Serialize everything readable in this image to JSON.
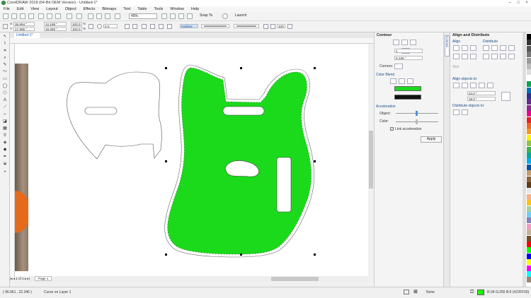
{
  "window": {
    "title": "CorelDRAW 2018 (64-Bit OEM Version) - Untitled-1*"
  },
  "menu": [
    "File",
    "Edit",
    "View",
    "Layout",
    "Object",
    "Effects",
    "Bitmaps",
    "Text",
    "Table",
    "Tools",
    "Window",
    "Help"
  ],
  "toolbar": {
    "zoom": "45%",
    "snap": "Snap To",
    "launch": "Launch"
  },
  "propbar": {
    "x": "36.994 \"",
    "y": "17.685 \"",
    "w": "12.188 \"",
    "h": "15.083 \"",
    "sx": "100.0",
    "sy": "100.0",
    "sx_unit": "%",
    "sy_unit": "%",
    "angle": "0.0",
    "outline": "Hairline",
    "opacity": "100"
  },
  "document": {
    "tab": "Untitled-1*"
  },
  "pagebar": {
    "page_num": "1",
    "page_of": "of",
    "page_total": "1",
    "page_label": "Page 1"
  },
  "contour": {
    "title": "Contour",
    "steps": "1",
    "offset": "0.125 \"",
    "corners_label": "Corners:",
    "color_blend": "Color Blend",
    "acceleration": "Acceleration",
    "object_label": "Object:",
    "color_label": "Color:",
    "link_label": "Link acceleration",
    "apply": "Apply",
    "outline_color": "#1bd91b",
    "fill_color": "#111111"
  },
  "align": {
    "title": "Align and Distribute",
    "align_label": "Align",
    "distribute_label": "Distribute",
    "text_label": "Text",
    "align_objects_to": "Align objects to:",
    "distribute_objects_to": "Distribute objects to:",
    "x_field": "24.0 \"",
    "y_field": "18.0 \""
  },
  "sidetab": {
    "label": "Contour"
  },
  "status": {
    "coords": "( 46.961 , 22.346 )",
    "info": "Curve on Layer 1",
    "outline": "None",
    "fill": "R:34 G:255 B:0 (#22FF00)",
    "fill_color": "#22ff00"
  },
  "palette": [
    "#000000",
    "#333333",
    "#555555",
    "#777777",
    "#999999",
    "#bbbbbb",
    "#dddddd",
    "#ffffff",
    "#00a651",
    "#0072bc",
    "#2e3192",
    "#662d91",
    "#92278f",
    "#ec008c",
    "#ed1c24",
    "#f26522",
    "#f7941d",
    "#fff200",
    "#8dc63f",
    "#39b54a",
    "#00a99d",
    "#00aeef",
    "#0054a6",
    "#c69c6d",
    "#8c6239",
    "#603913",
    "#e6e6e6",
    "#f9ad81",
    "#ffc20e",
    "#a3d39c",
    "#6dcff6",
    "#8781bd",
    "#f49ac1",
    "#c7b299",
    "#754c24",
    "#ff0000",
    "#00ff00",
    "#0000ff",
    "#ffff00",
    "#ff00ff",
    "#00ffff",
    "#998675"
  ]
}
